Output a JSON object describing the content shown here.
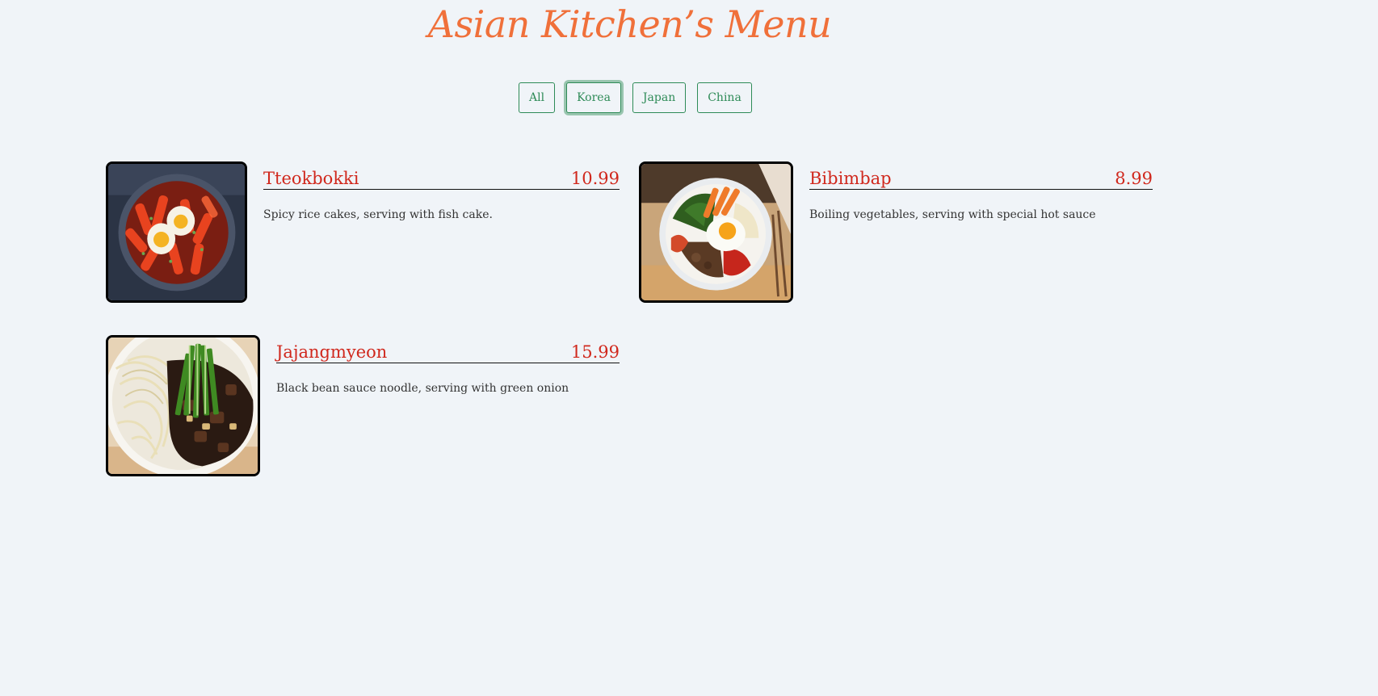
{
  "page": {
    "title": "Asian Kitchen’s Menu"
  },
  "filters": [
    {
      "label": "All",
      "active": false
    },
    {
      "label": "Korea",
      "active": true
    },
    {
      "label": "Japan",
      "active": false
    },
    {
      "label": "China",
      "active": false
    }
  ],
  "menu": [
    {
      "name": "Tteokbokki",
      "price": "10.99",
      "description": "Spicy rice cakes, serving with fish cake.",
      "image_icon": "tteokbokki-photo-icon"
    },
    {
      "name": "Bibimbap",
      "price": "8.99",
      "description": "Boiling vegetables, serving with special hot sauce",
      "image_icon": "bibimbap-photo-icon"
    },
    {
      "name": "Jajangmyeon",
      "price": "15.99",
      "description": "Black bean sauce noodle, serving with green onion",
      "image_icon": "jajangmyeon-photo-icon"
    }
  ],
  "colors": {
    "background": "#f0f4f8",
    "title": "#f0703a",
    "accent": "#2e8b57",
    "item_name": "#d0281d"
  }
}
